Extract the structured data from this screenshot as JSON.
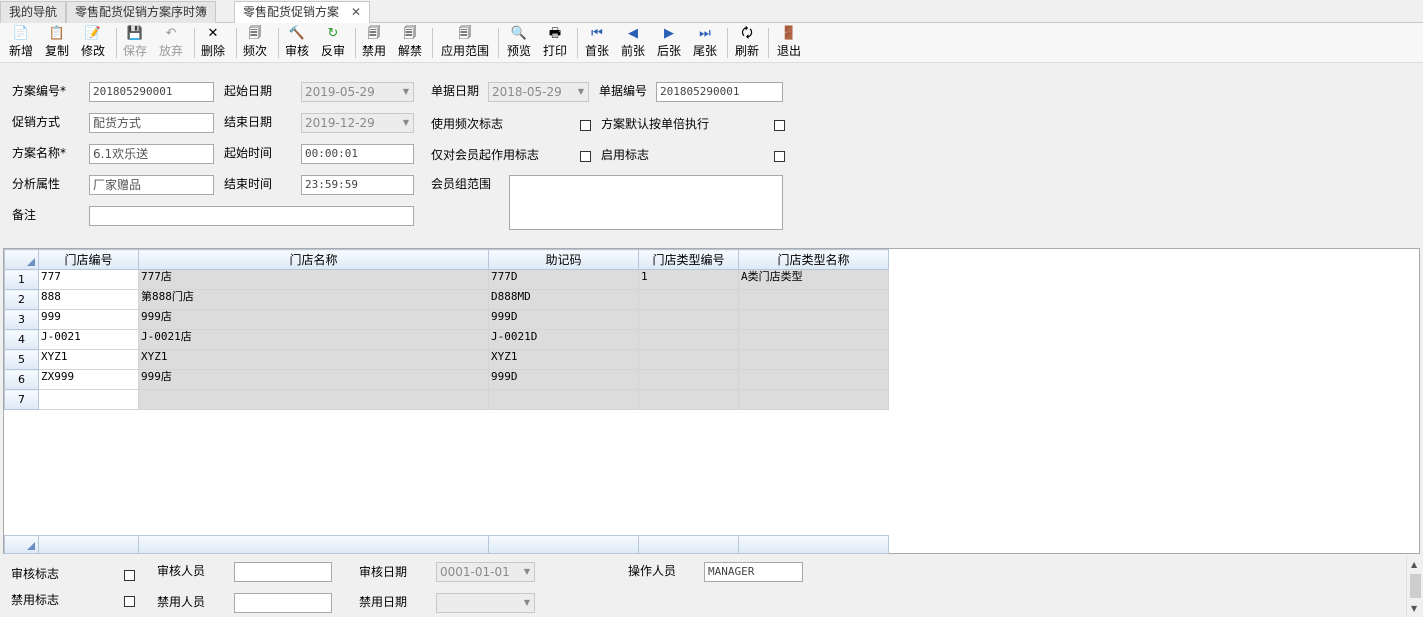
{
  "tabs": [
    {
      "label": "我的导航"
    },
    {
      "label": "零售配货促销方案序时簿"
    },
    {
      "label": "零售配货促销方案",
      "close": "✕"
    }
  ],
  "toolbar": [
    {
      "label": "新增",
      "icon": "📄"
    },
    {
      "label": "复制",
      "icon": "📋"
    },
    {
      "label": "修改",
      "icon": "📝"
    },
    {
      "label": "保存",
      "icon": "💾"
    },
    {
      "label": "放弃",
      "icon": "↶"
    },
    {
      "label": "删除",
      "icon": "✕"
    },
    {
      "label": "频次",
      "icon": "🗐"
    },
    {
      "label": "审核",
      "icon": "🔨"
    },
    {
      "label": "反审",
      "icon": "↻"
    },
    {
      "label": "禁用",
      "icon": "🗐"
    },
    {
      "label": "解禁",
      "icon": "🗐"
    },
    {
      "label": "应用范围",
      "icon": "🗐"
    },
    {
      "label": "预览",
      "icon": "🔍"
    },
    {
      "label": "打印",
      "icon": "🖶"
    },
    {
      "label": "首张",
      "icon": "⏮"
    },
    {
      "label": "前张",
      "icon": "◀"
    },
    {
      "label": "后张",
      "icon": "▶"
    },
    {
      "label": "尾张",
      "icon": "⏭"
    },
    {
      "label": "刷新",
      "icon": "🗘"
    },
    {
      "label": "退出",
      "icon": "🚪"
    }
  ],
  "form": {
    "plan_no_label": "方案编号*",
    "plan_no": "201805290001",
    "start_date_label": "起始日期",
    "start_date": "2019-05-29",
    "doc_date_label": "单据日期",
    "doc_date": "2018-05-29",
    "doc_no_label": "单据编号",
    "doc_no": "201805290001",
    "promo_mode_label": "促销方式",
    "promo_mode": "配货方式",
    "end_date_label": "结束日期",
    "end_date": "2019-12-29",
    "use_freq_label": "使用频次标志",
    "default_multiple_label": "方案默认按单倍执行",
    "plan_name_label": "方案名称*",
    "plan_name": "6.1欢乐送",
    "start_time_label": "起始时间",
    "start_time": "00:00:01",
    "member_only_label": "仅对会员起作用标志",
    "enable_label": "启用标志",
    "attr_label": "分析属性",
    "attr": "厂家赠品",
    "end_time_label": "结束时间",
    "end_time": "23:59:59",
    "member_group_label": "会员组范围",
    "remark_label": "备注",
    "remark": ""
  },
  "grid": {
    "columns": [
      "门店编号",
      "门店名称",
      "助记码",
      "门店类型编号",
      "门店类型名称"
    ],
    "rows": [
      {
        "n": "1",
        "cells": [
          "777",
          "777店",
          "777D",
          "1",
          "A类门店类型"
        ]
      },
      {
        "n": "2",
        "cells": [
          "888",
          "第888门店",
          "D888MD",
          "",
          ""
        ]
      },
      {
        "n": "3",
        "cells": [
          "999",
          "999店",
          "999D",
          "",
          ""
        ]
      },
      {
        "n": "4",
        "cells": [
          "J-0021",
          "J-0021店",
          "J-0021D",
          "",
          ""
        ]
      },
      {
        "n": "5",
        "cells": [
          "XYZ1",
          "XYZ1",
          "XYZ1",
          "",
          ""
        ]
      },
      {
        "n": "6",
        "cells": [
          "ZX999",
          "999店",
          "999D",
          "",
          ""
        ]
      },
      {
        "n": "7",
        "cells": [
          "",
          "",
          "",
          "",
          ""
        ]
      }
    ]
  },
  "bottom": {
    "audit_flag_label": "审核标志",
    "auditor_label": "审核人员",
    "auditor": "",
    "audit_date_label": "审核日期",
    "audit_date": "0001-01-01",
    "operator_label": "操作人员",
    "operator": "MANAGER",
    "disable_flag_label": "禁用标志",
    "disabler_label": "禁用人员",
    "disabler": "",
    "disable_date_label": "禁用日期",
    "disable_date": ""
  }
}
